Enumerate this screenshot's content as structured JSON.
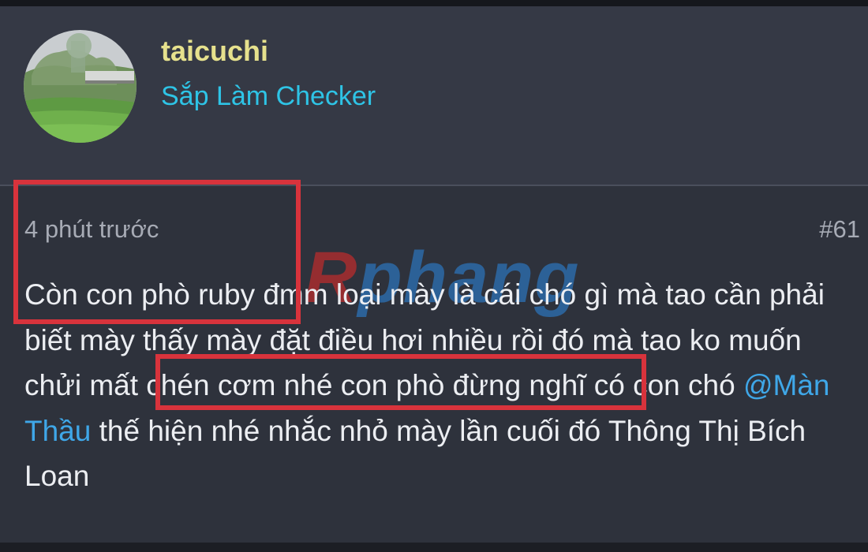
{
  "user": {
    "name": "taicuchi",
    "title": "Sắp Làm Checker",
    "avatar_icon": "landscape-avatar"
  },
  "post": {
    "time": "4 phút trước",
    "number": "#61",
    "text_part1": "Còn con phò ruby đmm loại mày là cái chó gì mà tao cần phải biết mày thấy mày đặt điều hơi nhiều rồi đó mà tao ko muốn chửi mất chén cơm nhé con phò đừng nghĩ có con chó ",
    "mention": "@Màn Thầu",
    "text_part2": " thế hiện nhé nhắc nhỏ mày lần cuối đó Thông Thị Bích Loan"
  },
  "watermark": {
    "first_letter": "R",
    "rest": "phang"
  },
  "colors": {
    "username": "#e6e18d",
    "user_title": "#2ec4e6",
    "mention": "#3fa7e8",
    "highlight_border": "#d8333c"
  }
}
